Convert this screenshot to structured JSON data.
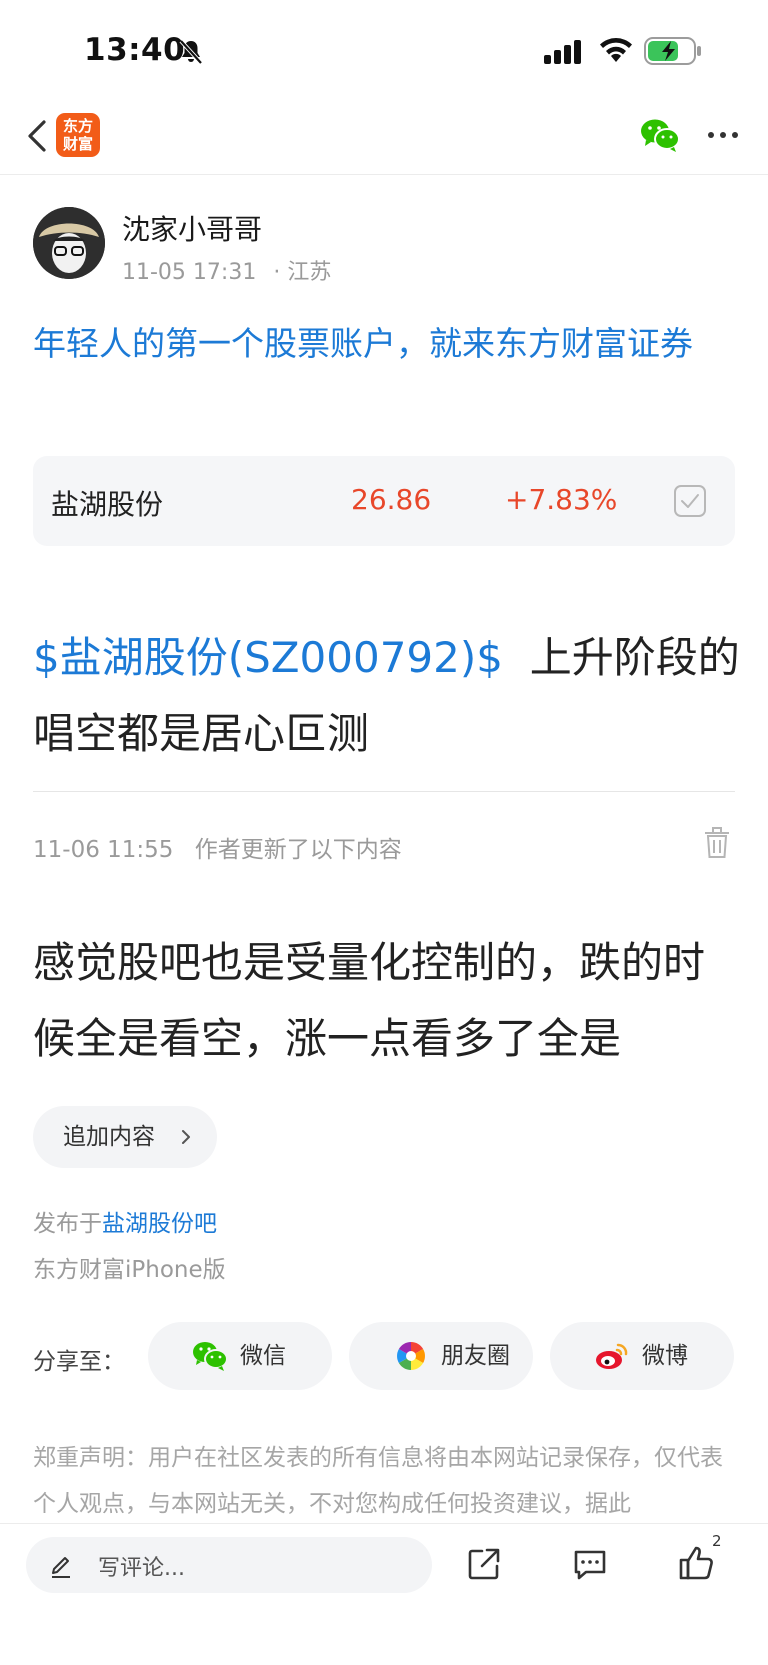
{
  "status_bar": {
    "time": "13:40"
  },
  "nav": {
    "logo_text": "东方财富"
  },
  "author": {
    "name": "沈家小哥哥",
    "date": "11-05 17:31",
    "location": "· 江苏"
  },
  "promo": {
    "text": "年轻人的第一个股票账户，就来东方财富证券"
  },
  "stock": {
    "name": "盐湖股份",
    "price": "26.86",
    "change": "+7.83%"
  },
  "post": {
    "tag": "$盐湖股份(SZ000792)$",
    "title": "上升阶段的唱空都是居心叵测"
  },
  "update": {
    "time": "11-06 11:55",
    "label": "作者更新了以下内容",
    "body": "感觉股吧也是受量化控制的，跌的时候全是看空，涨一点看多了全是"
  },
  "add_content": {
    "label": "追加内容"
  },
  "published": {
    "prefix": "发布于",
    "bar": "盐湖股份吧",
    "client": "东方财富iPhone版"
  },
  "share": {
    "label": "分享至：",
    "wechat": "微信",
    "moments": "朋友圈",
    "weibo": "微博"
  },
  "disclaimer": {
    "text": "郑重声明：用户在社区发表的所有信息将由本网站记录保存，仅代表个人观点，与本网站无关，不对您构成任何投资建议，据此"
  },
  "bottom_bar": {
    "comment_placeholder": "写评论...",
    "like_count": "2"
  },
  "colors": {
    "link": "#1c7ad6",
    "up": "#e8472a",
    "brand": "#f25c18",
    "wechat": "#2dc100"
  },
  "icons": [
    "bell-off-icon",
    "signal-icon",
    "wifi-icon",
    "battery-icon",
    "back-icon",
    "wechat-icon",
    "more-icon",
    "checkbox-icon",
    "trash-icon",
    "chevron-right-icon",
    "moments-icon",
    "weibo-icon",
    "pencil-icon",
    "share-out-icon",
    "comment-icon",
    "like-icon"
  ]
}
